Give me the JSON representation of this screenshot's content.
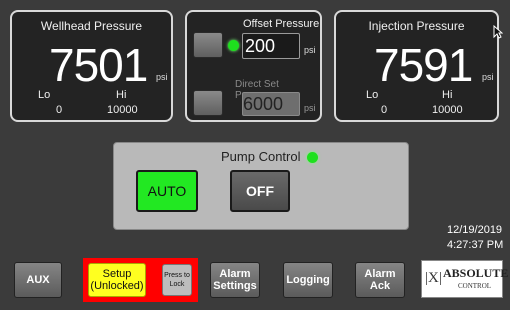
{
  "wellhead": {
    "title": "Wellhead Pressure",
    "value": "7501",
    "unit": "psi",
    "lo_label": "Lo",
    "hi_label": "Hi",
    "lo": "0",
    "hi": "10000"
  },
  "offset": {
    "title": "Offset Pressure",
    "value": "200",
    "unit": "psi"
  },
  "direct_set": {
    "title": "Direct Set Pressure",
    "value": "6000",
    "unit": "psi"
  },
  "injection": {
    "title": "Injection Pressure",
    "value": "7591",
    "unit": "psi",
    "lo_label": "Lo",
    "hi_label": "Hi",
    "lo": "0",
    "hi": "10000"
  },
  "pump": {
    "title": "Pump Control",
    "auto_label": "AUTO",
    "off_label": "OFF"
  },
  "datetime": {
    "date": "12/19/2019",
    "time": "4:27:37 PM"
  },
  "bottom_bar": {
    "aux": "AUX",
    "setup_line1": "Setup",
    "setup_line2": "(Unlocked)",
    "lock_line1": "Press to",
    "lock_line2": "Lock",
    "alarm_settings_line1": "Alarm",
    "alarm_settings_line2": "Settings",
    "logging": "Logging",
    "alarm_ack_line1": "Alarm",
    "alarm_ack_line2": "Ack"
  },
  "logo": {
    "mark": "|X|",
    "line1": "ABSOLUTE",
    "line2": "CONTROL"
  },
  "colors": {
    "led_green": "#1ee01e",
    "auto_green": "#22e822",
    "setup_yellow": "#ffff20",
    "setup_border": "#ff0000"
  }
}
